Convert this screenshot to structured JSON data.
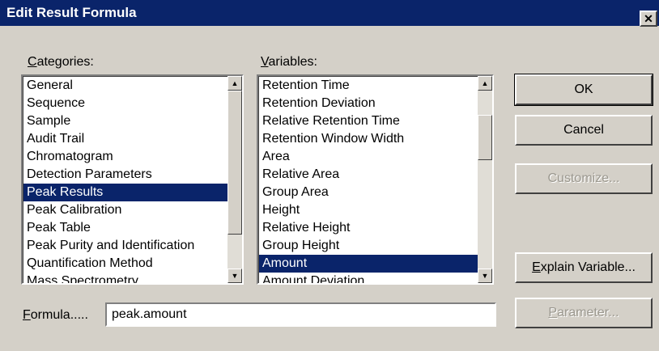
{
  "window": {
    "title": "Edit Result Formula",
    "close_glyph": "✕",
    "close_icon": "close-icon"
  },
  "categories": {
    "label_mnemonic": "C",
    "label_rest": "ategories:",
    "items": [
      "General",
      "Sequence",
      "Sample",
      "Audit Trail",
      "Chromatogram",
      "Detection Parameters",
      "Peak Results",
      "Peak Calibration",
      "Peak Table",
      "Peak Purity and Identification",
      "Quantification Method",
      "Mass Spectrometry"
    ],
    "selected": "Peak Results"
  },
  "variables": {
    "label_mnemonic": "V",
    "label_rest": "ariables:",
    "items": [
      "Retention Time",
      "Retention Deviation",
      "Relative Retention Time",
      "Retention Window Width",
      "Area",
      "Relative Area",
      "Group Area",
      "Height",
      "Relative Height",
      "Group Height",
      "Amount",
      "Amount Deviation"
    ],
    "selected": "Amount"
  },
  "buttons": {
    "ok": "OK",
    "cancel": "Cancel",
    "customize": "Customize...",
    "explain_mnemonic": "E",
    "explain_rest": "xplain Variable...",
    "parameter_mnemonic": "P",
    "parameter_rest": "arameter..."
  },
  "formula": {
    "label_mnemonic": "F",
    "label_rest": "ormula.....",
    "value": "peak.amount"
  },
  "colors": {
    "titlebar": "#0a246a",
    "face": "#d4d0c8",
    "selection": "#0a246a"
  },
  "scroll_arrow_up": "▲",
  "scroll_arrow_down": "▼"
}
